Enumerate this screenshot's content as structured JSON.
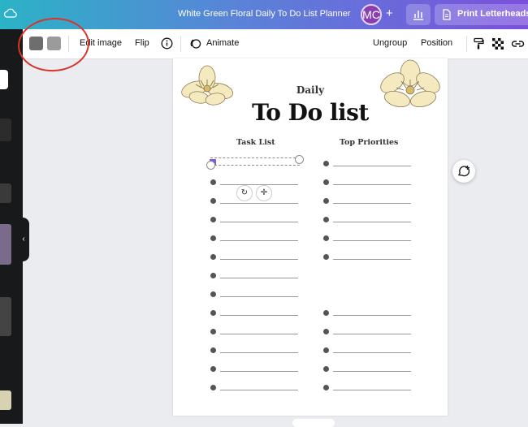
{
  "header": {
    "document_title": "White Green Floral Daily To Do List Planner",
    "avatar_initials": "MC",
    "add_symbol": "+",
    "share_button_label": "Print Letterheads"
  },
  "toolbar": {
    "swatch_colors": [
      "#6e6e6e",
      "#9b9b9b"
    ],
    "edit_image_label": "Edit image",
    "flip_label": "Flip",
    "animate_label": "Animate",
    "ungroup_label": "Ungroup",
    "position_label": "Position"
  },
  "sidebar": {
    "collapse_symbol": "‹"
  },
  "canvas": {
    "subtitle": "Daily",
    "title": "To Do list",
    "task_column_heading": "Task List",
    "priority_column_heading": "Top Priorities"
  },
  "annotation": {
    "circle_color": "#d9342b"
  }
}
